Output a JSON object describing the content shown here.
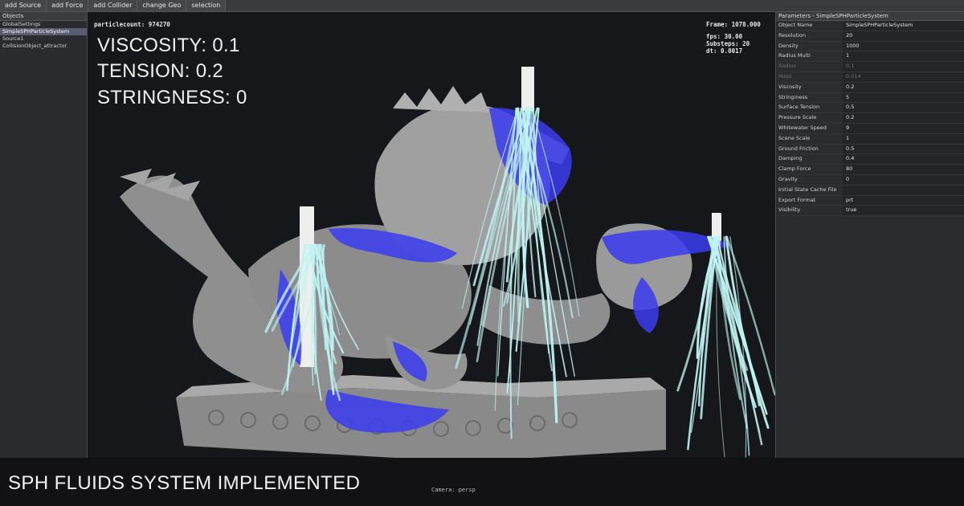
{
  "toolbar": {
    "buttons": [
      "add Source",
      "add Force",
      "add Collider",
      "change Geo",
      "selection"
    ]
  },
  "objects_panel": {
    "title": "Objects",
    "items": [
      {
        "label": "GlobalSettings",
        "selected": false
      },
      {
        "label": "SimpleSPHParticleSystem",
        "selected": true
      },
      {
        "label": "Source1",
        "selected": false
      },
      {
        "label": "CollisionObject_attractor",
        "selected": false
      }
    ]
  },
  "viewport": {
    "particlecount": "particlecount: 974270",
    "frame": "Frame: 1078.000",
    "fps": "fps: 30.00",
    "substeps": "Substeps: 20",
    "dt": "dt: 0.0017",
    "overlay": {
      "viscosity": "VISCOSITY: 0.1",
      "tension": "TENSION: 0.2",
      "stringness": "STRINGNESS: 0"
    },
    "camera": "Camera: persp"
  },
  "parameters_panel": {
    "title": "Parameters - SimpleSPHParticleSystem",
    "rows": [
      {
        "label": "Object Name",
        "value": "SimpleSPHParticleSystem",
        "enabled": true
      },
      {
        "label": "Resolution",
        "value": "20",
        "enabled": true
      },
      {
        "label": "Density",
        "value": "1000",
        "enabled": true
      },
      {
        "label": "Radius Multi",
        "value": "1",
        "enabled": true
      },
      {
        "label": "Radius",
        "value": "0.1",
        "enabled": false
      },
      {
        "label": "Mass",
        "value": "0.014",
        "enabled": false
      },
      {
        "label": "Viscosity",
        "value": "0.2",
        "enabled": true
      },
      {
        "label": "Stringiness",
        "value": "5",
        "enabled": true
      },
      {
        "label": "Surface Tension",
        "value": "0.5",
        "enabled": true
      },
      {
        "label": "Pressure Scale",
        "value": "0.2",
        "enabled": true
      },
      {
        "label": "Whitewater Speed",
        "value": "9",
        "enabled": true
      },
      {
        "label": "Scene Scale",
        "value": "1",
        "enabled": true
      },
      {
        "label": "Ground Friction",
        "value": "0.5",
        "enabled": true
      },
      {
        "label": "Damping",
        "value": "0.4",
        "enabled": true
      },
      {
        "label": "Clamp Force",
        "value": "80",
        "enabled": true
      },
      {
        "label": "Gravity",
        "value": "0",
        "enabled": true
      },
      {
        "label": "Initial State Cache File",
        "value": "",
        "enabled": true
      },
      {
        "label": "Export Format",
        "value": "prt",
        "enabled": true
      },
      {
        "label": "Visibility",
        "value": "true",
        "enabled": true
      }
    ]
  },
  "caption": "SPH FLUIDS SYSTEM IMPLEMENTED",
  "colors": {
    "fluid_blue": "#3a3cf0",
    "whitewater": "#bff3f3",
    "statue_gray": "#9a9a9a",
    "selection": "#5a5d72"
  }
}
